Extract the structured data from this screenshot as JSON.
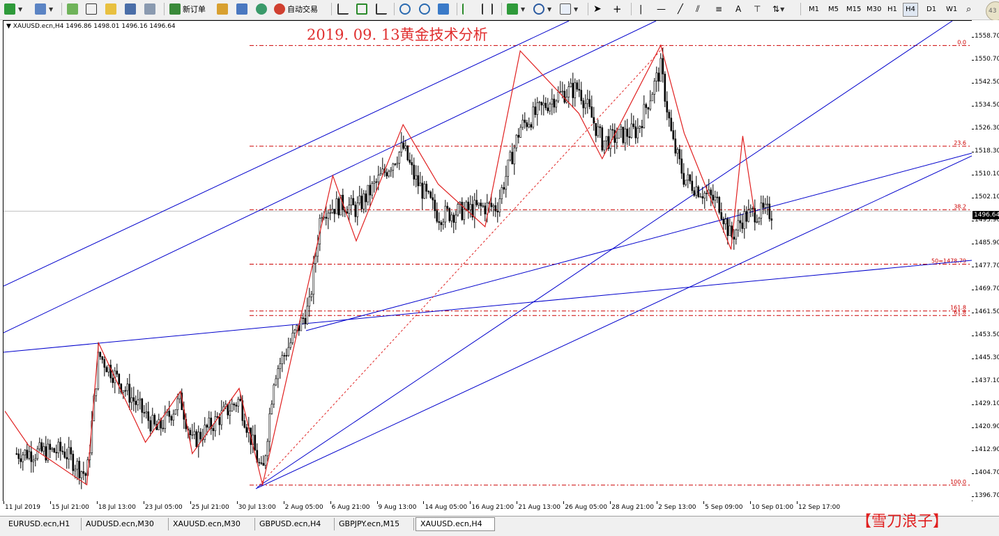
{
  "toolbar": {
    "new_order_label": "新订单",
    "auto_trading_label": "自动交易",
    "timeframes": [
      "M1",
      "M5",
      "M15",
      "M30",
      "H1",
      "H4",
      "D1",
      "W1"
    ],
    "active_timeframe": "H4",
    "avatar_text": "43"
  },
  "chart": {
    "symbol_info": "▼ XAUUSD.ecn,H4  1496.86 1498.01 1496.16 1496.64",
    "title": "2019. 09. 13黄金技术分析",
    "current_price": "1496.64",
    "price_labels": [
      "1558.70",
      "1550.70",
      "1542.50",
      "1534.50",
      "1526.30",
      "1518.30",
      "1510.10",
      "1502.10",
      "1493.90",
      "1485.90",
      "1477.70",
      "1469.70",
      "1461.50",
      "1453.50",
      "1445.30",
      "1437.10",
      "1429.10",
      "1420.90",
      "1412.90",
      "1404.70",
      "1396.70"
    ],
    "time_labels": [
      "11 Jul 2019",
      "15 Jul 21:00",
      "18 Jul 13:00",
      "23 Jul 05:00",
      "25 Jul 21:00",
      "30 Jul 13:00",
      "2 Aug 05:00",
      "6 Aug 21:00",
      "9 Aug 13:00",
      "14 Aug 05:00",
      "16 Aug 21:00",
      "21 Aug 13:00",
      "26 Aug 05:00",
      "28 Aug 21:00",
      "2 Sep 13:00",
      "5 Sep 09:00",
      "10 Sep 01:00",
      "12 Sep 17:00"
    ],
    "fib_levels": [
      {
        "label": "0.0",
        "price": 1555.9
      },
      {
        "label": "23.6",
        "price": 1520.4
      },
      {
        "label": "38.2",
        "price": 1498.0
      },
      {
        "label": "50=1478.79",
        "price": 1478.79
      },
      {
        "label": "161.8",
        "price": 1462.3
      },
      {
        "label": "61.8",
        "price": 1460.7
      },
      {
        "label": "100.0",
        "price": 1400.9
      }
    ],
    "colors": {
      "candle": "#000000",
      "zigzag": "#e02020",
      "channel": "#0000cc",
      "fib": "#cc0000",
      "title": "#e03030"
    }
  },
  "chart_data": {
    "type": "candlestick",
    "instrument": "XAUUSD.ecn",
    "timeframe": "H4",
    "last_bar": {
      "open": 1496.86,
      "high": 1498.01,
      "low": 1496.16,
      "close": 1496.64
    },
    "ylim": [
      1396.7,
      1558.7
    ],
    "x_range": [
      "11 Jul 2019",
      "12 Sep 2019"
    ],
    "grid": false,
    "zigzag_pivots": [
      {
        "date": "10 Jul",
        "price": 1427
      },
      {
        "date": "12 Jul",
        "price": 1415
      },
      {
        "date": "17 Jul",
        "price": 1401
      },
      {
        "date": "18 Jul",
        "price": 1451
      },
      {
        "date": "22 Jul",
        "price": 1416
      },
      {
        "date": "25 Jul",
        "price": 1434
      },
      {
        "date": "26 Jul",
        "price": 1412
      },
      {
        "date": "30 Jul",
        "price": 1435
      },
      {
        "date": "1 Aug",
        "price": 1401
      },
      {
        "date": "7 Aug",
        "price": 1510
      },
      {
        "date": "9 Aug",
        "price": 1487
      },
      {
        "date": "13 Aug",
        "price": 1528
      },
      {
        "date": "16 Aug",
        "price": 1507
      },
      {
        "date": "20 Aug",
        "price": 1492
      },
      {
        "date": "23 Aug",
        "price": 1554
      },
      {
        "date": "28 Aug",
        "price": 1532
      },
      {
        "date": "30 Aug",
        "price": 1516
      },
      {
        "date": "4 Sep",
        "price": 1556
      },
      {
        "date": "6 Sep",
        "price": 1525
      },
      {
        "date": "10 Sep",
        "price": 1484
      },
      {
        "date": "11 Sep",
        "price": 1524
      },
      {
        "date": "12 Sep",
        "price": 1497
      }
    ],
    "price_series": [
      {
        "date": "11 Jul",
        "price": 1412
      },
      {
        "date": "15 Jul",
        "price": 1413
      },
      {
        "date": "17 Jul",
        "price": 1404
      },
      {
        "date": "18 Jul",
        "price": 1447
      },
      {
        "date": "23 Jul",
        "price": 1420
      },
      {
        "date": "25 Jul",
        "price": 1431
      },
      {
        "date": "26 Jul",
        "price": 1416
      },
      {
        "date": "30 Jul",
        "price": 1431
      },
      {
        "date": "1 Aug",
        "price": 1404
      },
      {
        "date": "2 Aug",
        "price": 1440
      },
      {
        "date": "5 Aug",
        "price": 1464
      },
      {
        "date": "6 Aug",
        "price": 1498
      },
      {
        "date": "8 Aug",
        "price": 1500
      },
      {
        "date": "9 Aug",
        "price": 1498
      },
      {
        "date": "13 Aug",
        "price": 1520
      },
      {
        "date": "14 Aug",
        "price": 1509
      },
      {
        "date": "16 Aug",
        "price": 1496
      },
      {
        "date": "20 Aug",
        "price": 1499
      },
      {
        "date": "21 Aug",
        "price": 1499
      },
      {
        "date": "23 Aug",
        "price": 1527
      },
      {
        "date": "26 Aug",
        "price": 1538
      },
      {
        "date": "28 Aug",
        "price": 1541
      },
      {
        "date": "30 Aug",
        "price": 1522
      },
      {
        "date": "2 Sep",
        "price": 1526
      },
      {
        "date": "4 Sep",
        "price": 1548
      },
      {
        "date": "5 Sep",
        "price": 1522
      },
      {
        "date": "6 Sep",
        "price": 1509
      },
      {
        "date": "9 Sep",
        "price": 1500
      },
      {
        "date": "10 Sep",
        "price": 1488
      },
      {
        "date": "11 Sep",
        "price": 1495
      },
      {
        "date": "12 Sep",
        "price": 1497
      }
    ]
  },
  "tabs": [
    "EURUSD.ecn,H1",
    "AUDUSD.ecn,M30",
    "XAUUSD.ecn,M30",
    "GBPUSD.ecn,H4",
    "GBPJPY.ecn,M15",
    "XAUUSD.ecn,H4"
  ],
  "active_tab": "XAUUSD.ecn,H4",
  "watermark": "【雪刀浪子】"
}
